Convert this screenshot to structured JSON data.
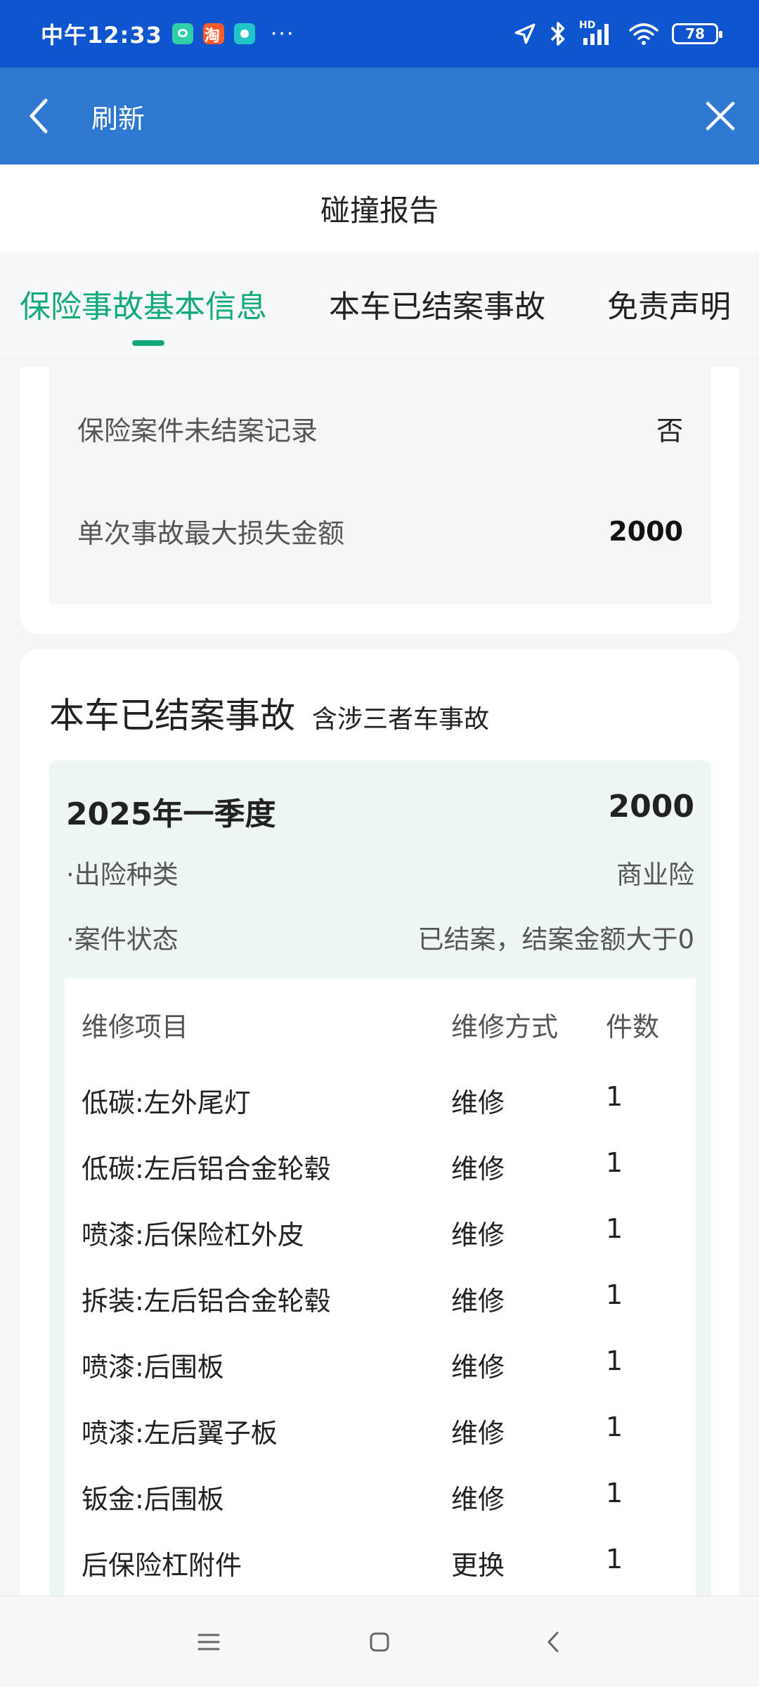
{
  "status_bar": {
    "time": "中午12:33",
    "more": "···",
    "hd_label": "HD",
    "battery": "78"
  },
  "app_bar": {
    "title": "刷新"
  },
  "page": {
    "title": "碰撞报告"
  },
  "tabs": [
    {
      "label": "保险事故基本信息",
      "active": true
    },
    {
      "label": "本车已结案事故",
      "active": false
    },
    {
      "label": "免责声明",
      "active": false
    }
  ],
  "basic_info": {
    "rows": [
      {
        "label": "保险案件未结案记录",
        "value": "否"
      },
      {
        "label": "单次事故最大损失金额",
        "value": "2000"
      }
    ]
  },
  "settled": {
    "title": "本车已结案事故",
    "subtitle": "含涉三者车事故",
    "claim": {
      "period": "2025年一季度",
      "amount": "2000",
      "details": [
        {
          "label": "·出险种类",
          "value": "商业险"
        },
        {
          "label": "·案件状态",
          "value": "已结案，结案金额大于0"
        }
      ],
      "repair_table": {
        "headers": [
          "维修项目",
          "维修方式",
          "件数"
        ],
        "rows": [
          [
            "低碳:左外尾灯",
            "维修",
            "1"
          ],
          [
            "低碳:左后铝合金轮毂",
            "维修",
            "1"
          ],
          [
            "喷漆:后保险杠外皮",
            "维修",
            "1"
          ],
          [
            "拆装:左后铝合金轮毂",
            "维修",
            "1"
          ],
          [
            "喷漆:后围板",
            "维修",
            "1"
          ],
          [
            "喷漆:左后翼子板",
            "维修",
            "1"
          ],
          [
            "钣金:后围板",
            "维修",
            "1"
          ],
          [
            "后保险杠附件",
            "更换",
            "1"
          ]
        ]
      }
    }
  },
  "colors": {
    "status_bar": "#0e55cf",
    "app_bar": "#2f78d2",
    "accent": "#12a97d",
    "claim_bg": "#eef6f4"
  }
}
